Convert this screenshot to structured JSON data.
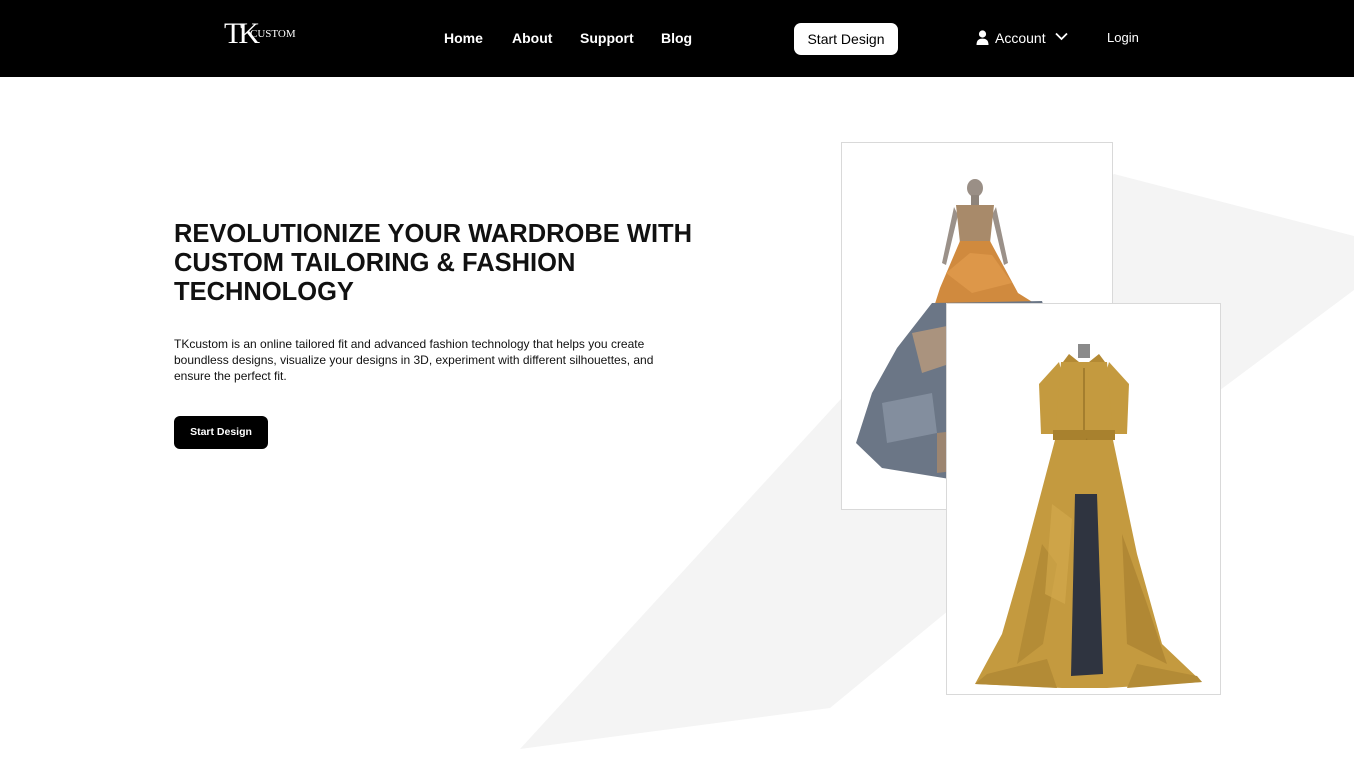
{
  "brand": {
    "logo_mark": "TK",
    "logo_word": "CUSTOM"
  },
  "nav": {
    "links": [
      "Home",
      "About",
      "Support",
      "Blog"
    ],
    "start_design": "Start Design",
    "account": "Account",
    "login": "Login"
  },
  "hero": {
    "headline": "REVOLUTIONIZE YOUR WARDROBE WITH CUSTOM TAILORING & FASHION TECHNOLOGY",
    "description": "TKcustom is an online tailored fit and advanced fashion technology that helps you create boundless designs, visualize your designs in 3D, experiment with different silhouettes, and ensure the perfect fit.",
    "cta": "Start Design"
  },
  "colors": {
    "header_bg": "#000000",
    "page_bg": "#ffffff",
    "bg_shape": "#f4f4f4",
    "dress1_top": "#a88a6a",
    "dress1_skirt": "#d08a3e",
    "dress1_ruffles": "#6b7686",
    "dress2": "#c49a3f"
  },
  "icons": {
    "account": "user-icon",
    "account_menu": "chevron-down-icon"
  }
}
